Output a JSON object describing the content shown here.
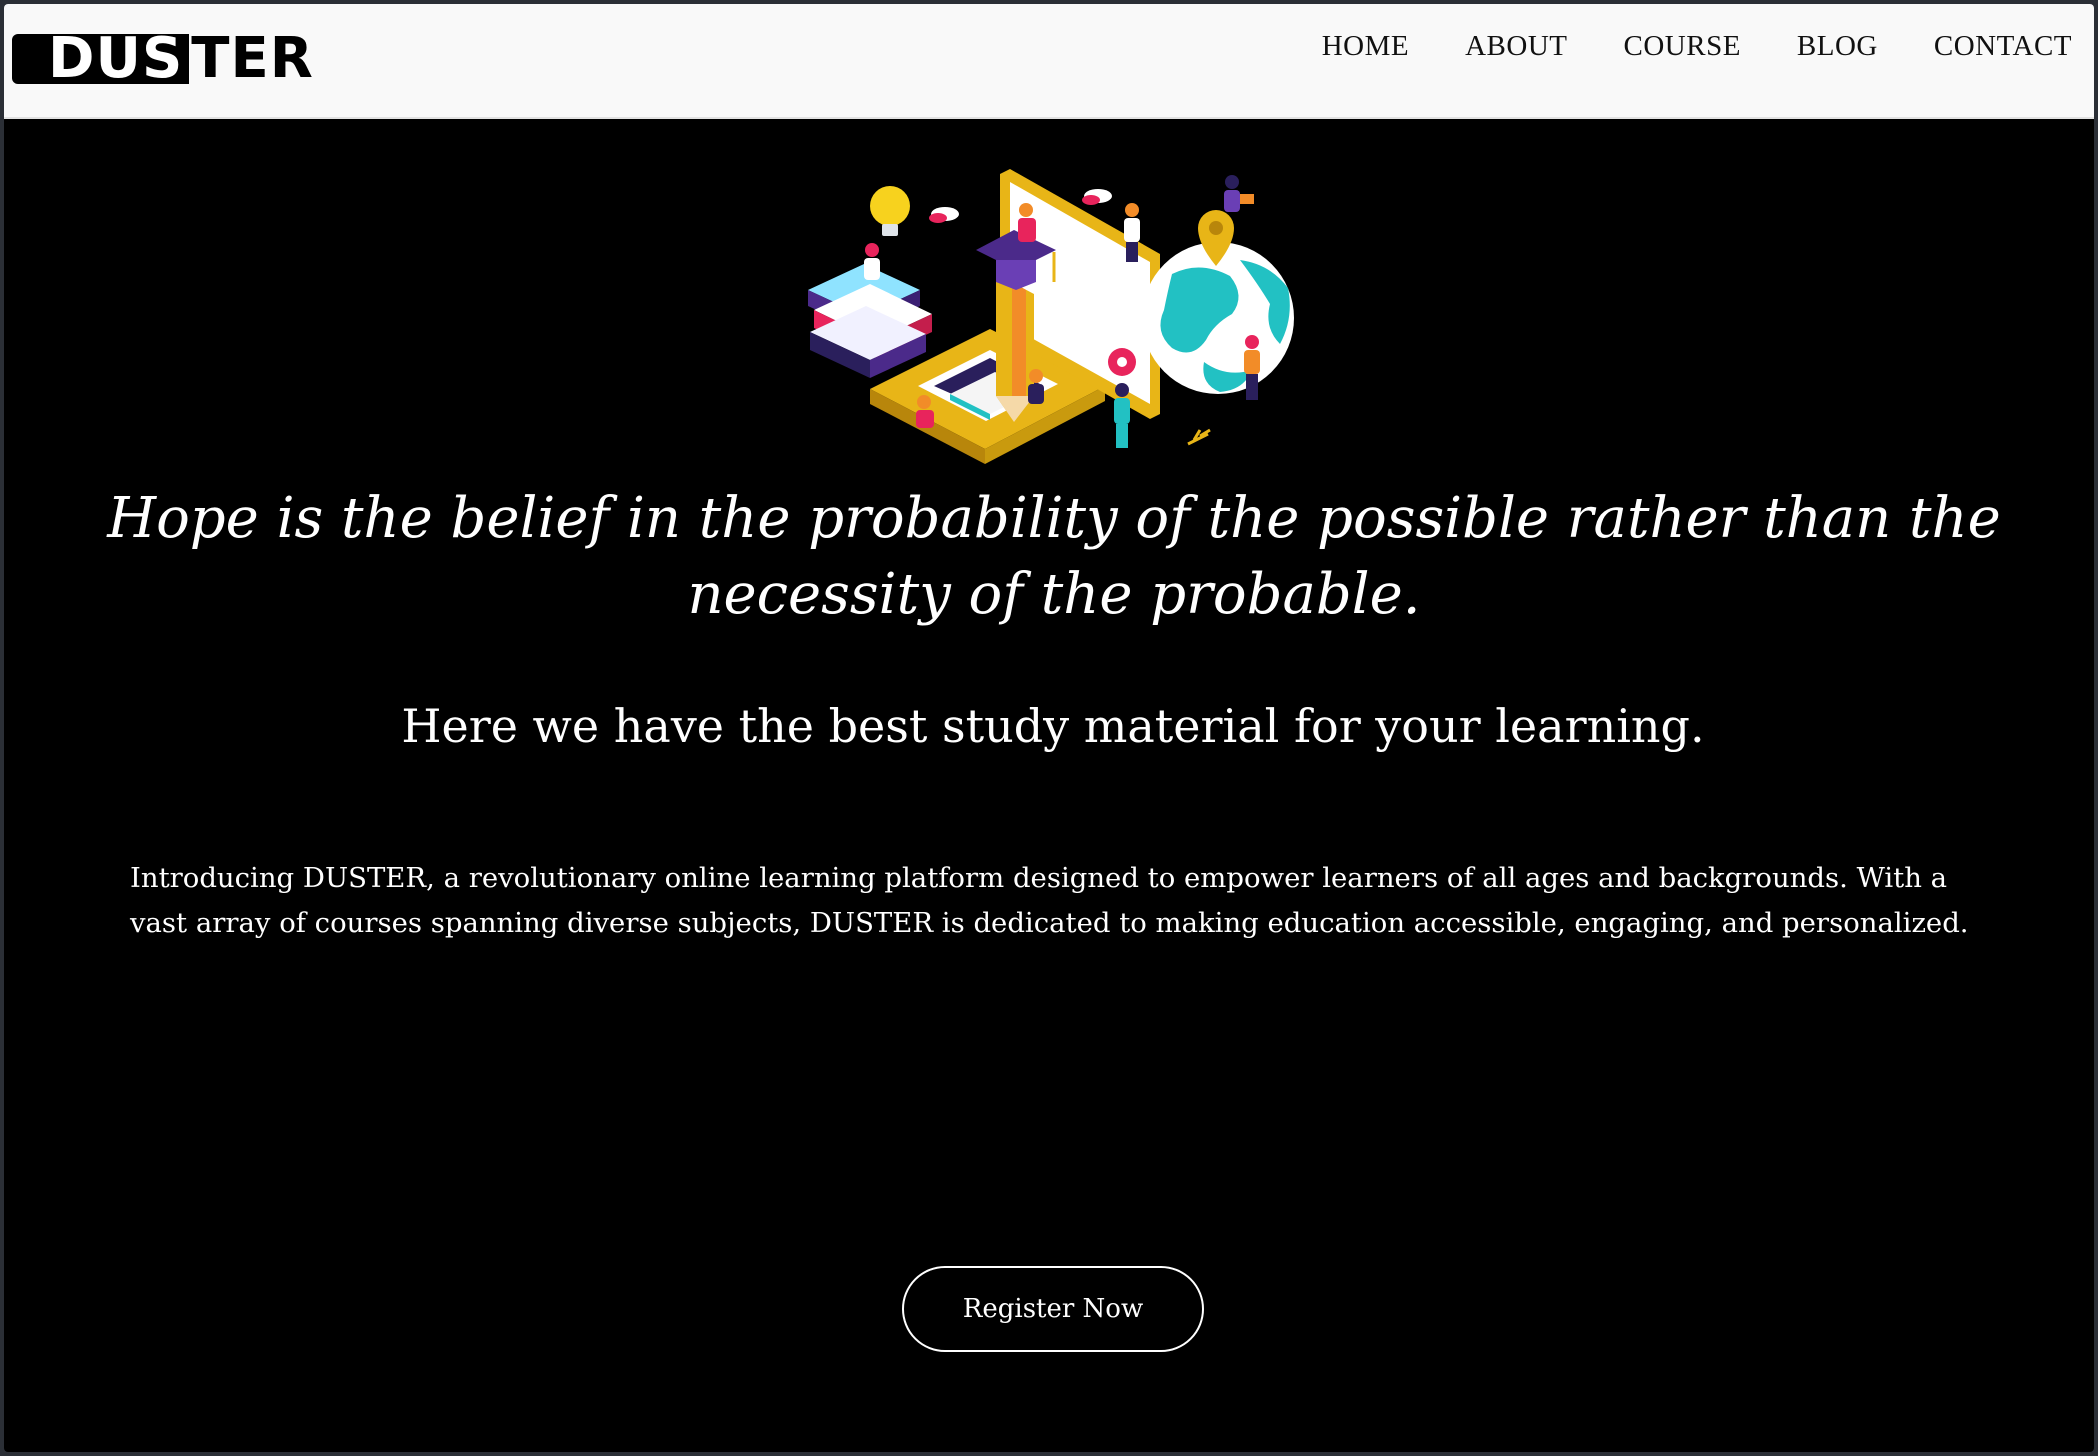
{
  "brand": {
    "logo_part_dark": "DUS",
    "logo_part_light": "TER"
  },
  "nav": {
    "items": [
      {
        "label": "HOME"
      },
      {
        "label": "ABOUT"
      },
      {
        "label": "COURSE"
      },
      {
        "label": "BLOG"
      },
      {
        "label": "CONTACT"
      }
    ]
  },
  "hero": {
    "illustration_icon": "isometric-learning-illustration-icon",
    "quote": "Hope is the belief in the probability of the possible rather than the necessity of the probable.",
    "subheading": "Here we have the best study material for your learning.",
    "intro": "Introducing DUSTER, a revolutionary online learning platform designed to empower learners of all ages and backgrounds. With a vast array of courses spanning diverse subjects, DUSTER is dedicated to making education accessible, engaging, and personalized.",
    "cta_label": "Register Now"
  },
  "colors": {
    "page_background": "#000000",
    "navbar_background": "#f9f9f9",
    "text": "#ffffff",
    "accent_yellow": "#e8b517",
    "accent_teal": "#22c1c3",
    "accent_pink": "#e8245c",
    "accent_purple": "#4b2a8a"
  }
}
